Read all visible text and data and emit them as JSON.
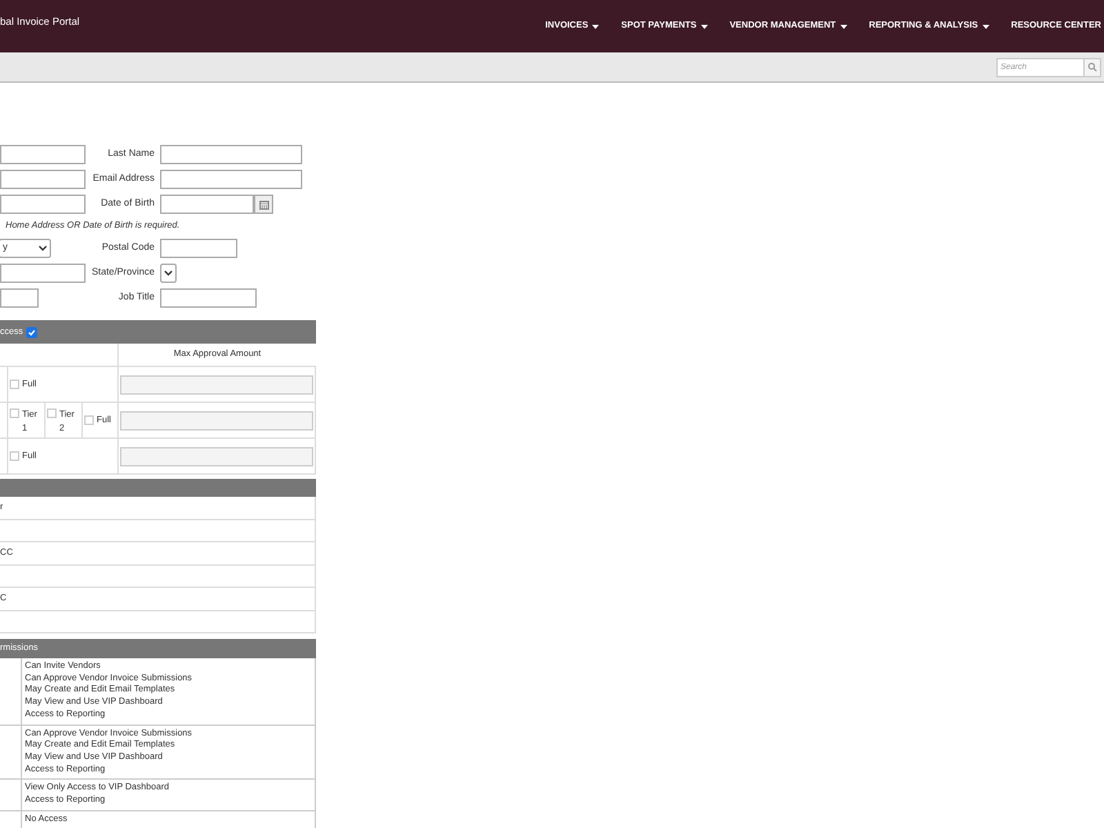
{
  "header": {
    "title": "bal Invoice Portal",
    "nav": [
      {
        "label": "INVOICES"
      },
      {
        "label": "SPOT PAYMENTS"
      },
      {
        "label": "VENDOR MANAGEMENT"
      },
      {
        "label": "REPORTING & ANALYSIS"
      },
      {
        "label": "RESOURCE CENTER"
      }
    ]
  },
  "search": {
    "placeholder": "Search"
  },
  "form": {
    "rows": [
      {
        "left": {
          "kind": "input"
        },
        "label": "Last Name",
        "right": {
          "kind": "input"
        }
      },
      {
        "left": {
          "kind": "input"
        },
        "label": "Email Address",
        "right": {
          "kind": "input"
        }
      },
      {
        "left": {
          "kind": "input"
        },
        "label": "Date of Birth",
        "right": {
          "kind": "date"
        }
      },
      {
        "note": "Home Address OR Date of Birth is required."
      },
      {
        "left": {
          "kind": "select",
          "value": "y"
        },
        "label": "Postal Code",
        "right": {
          "kind": "input"
        }
      },
      {
        "left": {
          "kind": "input"
        },
        "label": "State/Province",
        "right": {
          "kind": "select"
        }
      },
      {
        "left": {
          "kind": "input"
        },
        "label": "Job Title",
        "right": {
          "kind": "input"
        }
      }
    ]
  },
  "access_table": {
    "header": "ccess",
    "header_checked": true,
    "column_header": "Max Approval Amount",
    "rows": [
      {
        "options": [
          {
            "label": "Full",
            "checked": false
          }
        ]
      },
      {
        "options": [
          {
            "label": "Tier 1",
            "checked": false
          },
          {
            "label": "Tier 2",
            "checked": false
          },
          {
            "label": "Full",
            "checked": false
          }
        ]
      },
      {
        "options": [
          {
            "label": "Full",
            "checked": false
          }
        ]
      }
    ]
  },
  "list_table": {
    "rows": [
      "r",
      "",
      "CC",
      "",
      "C",
      ""
    ]
  },
  "permissions_table": {
    "header": "rmissions",
    "rows": [
      {
        "items": [
          "Can Invite Vendors",
          "Can Approve Vendor Invoice Submissions",
          "May Create and Edit Email Templates",
          "May View and Use VIP Dashboard",
          "Access to Reporting"
        ]
      },
      {
        "items": [
          "Can Approve Vendor Invoice Submissions",
          "May Create and Edit Email Templates",
          "May View and Use VIP Dashboard",
          "Access to Reporting"
        ]
      },
      {
        "items": [
          "View Only Access to VIP Dashboard",
          "Access to Reporting"
        ]
      },
      {
        "items": [
          "No Access"
        ]
      }
    ]
  }
}
